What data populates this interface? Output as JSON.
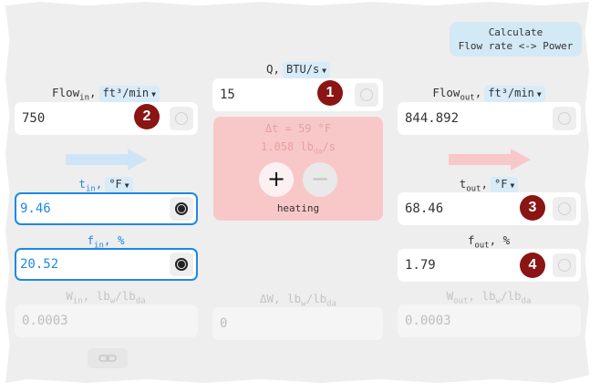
{
  "calculate_button": {
    "line1": "Calculate",
    "line2": "Flow rate <-> Power"
  },
  "q": {
    "label": "Q,",
    "unit": "BTU/s",
    "value": "15",
    "badge": "1"
  },
  "flow_in": {
    "label": "Flow",
    "sub": "in",
    "comma": ",",
    "unit": "ft³/min",
    "value": "750",
    "badge": "2"
  },
  "flow_out": {
    "label": "Flow",
    "sub": "out",
    "comma": ",",
    "unit": "ft³/min",
    "value": "844.892"
  },
  "delta_t": {
    "text": "Δt = 59 °F"
  },
  "mass_flow": {
    "value": "1.058 lb",
    "sub": "da",
    "suffix": "/s"
  },
  "controls": {
    "plus": "+",
    "minus": "−",
    "mode": "heating"
  },
  "t_in": {
    "label": "t",
    "sub": "in",
    "comma": ",",
    "unit": "°F",
    "value": "9.46"
  },
  "t_out": {
    "label": "t",
    "sub": "out",
    "comma": ",",
    "unit": "°F",
    "value": "68.46",
    "badge": "3"
  },
  "f_in": {
    "label": "f",
    "sub": "in",
    "unit_text": ", %",
    "value": "20.52"
  },
  "f_out": {
    "label": "f",
    "sub": "out",
    "unit_text": ", %",
    "value": "1.79",
    "badge": "4"
  },
  "w_in": {
    "label": "W",
    "sub": "in",
    "unit_a": ", lb",
    "unit_a_sub": "w",
    "unit_b": "/lb",
    "unit_b_sub": "da",
    "value": "0.0003"
  },
  "delta_w": {
    "label": "ΔW, lb",
    "unit_a_sub": "w",
    "unit_b": "/lb",
    "unit_b_sub": "da",
    "value": "0"
  },
  "w_out": {
    "label": "W",
    "sub": "out",
    "unit_a": ", lb",
    "unit_a_sub": "w",
    "unit_b": "/lb",
    "unit_b_sub": "da",
    "value": "0.0003"
  },
  "colors": {
    "accent": "#1e88e5",
    "badge": "#8b1414",
    "heating_panel": "#f8c8c8",
    "arrow_in": "#cfe5f7",
    "arrow_out": "#f8c8c8"
  },
  "icons": {
    "link": "link-icon",
    "arrow_in": "arrow-right-icon",
    "arrow_out": "arrow-right-icon"
  }
}
